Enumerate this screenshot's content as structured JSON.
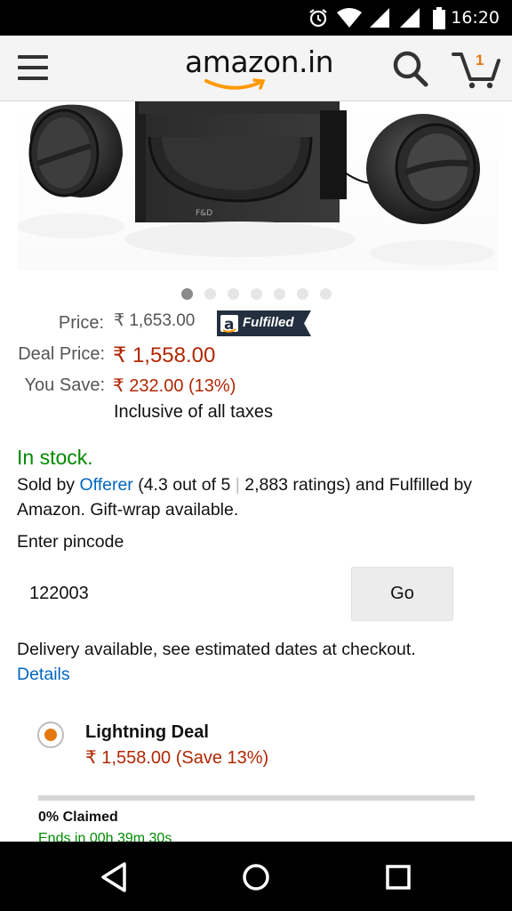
{
  "status_bar": {
    "time": "16:20",
    "icons": [
      "alarm-icon",
      "wifi-icon",
      "signal-icon",
      "signal-icon",
      "battery-icon"
    ]
  },
  "header": {
    "logo_text": "amazon.in",
    "cart_count": "1",
    "icons": [
      "menu-icon",
      "search-icon",
      "cart-icon"
    ]
  },
  "product": {
    "image_count": 7,
    "active_image": 1
  },
  "pricing": {
    "price_label": "Price:",
    "price_value": "₹ 1,653.00",
    "fulfilled_badge": "Fulfilled",
    "deal_label": "Deal Price:",
    "deal_value": "₹ 1,558.00",
    "save_label": "You Save:",
    "save_value": "₹ 232.00 (13%)",
    "tax_note": "Inclusive of all taxes"
  },
  "availability": {
    "status": "In stock.",
    "sold_by_prefix": "Sold by",
    "seller": "Offerer",
    "rating_part1": "(4.3 out of 5",
    "rating_sep": "|",
    "rating_part2": "2,883 ratings) and Fulfilled by Amazon. Gift-wrap available."
  },
  "pincode": {
    "label": "Enter pincode",
    "value": "122003",
    "button": "Go"
  },
  "delivery": {
    "text": "Delivery available, see estimated dates at checkout.",
    "details_link": "Details"
  },
  "deal": {
    "title": "Lightning Deal",
    "price": "₹ 1,558.00 (Save 13%)",
    "claimed_percent": 0,
    "claimed_text": "0% Claimed",
    "ends_text": "Ends in 00h 39m 30s"
  },
  "colors": {
    "price_red": "#b12704",
    "in_stock_green": "#008a00",
    "link_blue": "#0066c0",
    "accent_orange": "#e47911"
  },
  "nav_bar": {
    "icons": [
      "back-icon",
      "home-icon",
      "recents-icon"
    ]
  }
}
